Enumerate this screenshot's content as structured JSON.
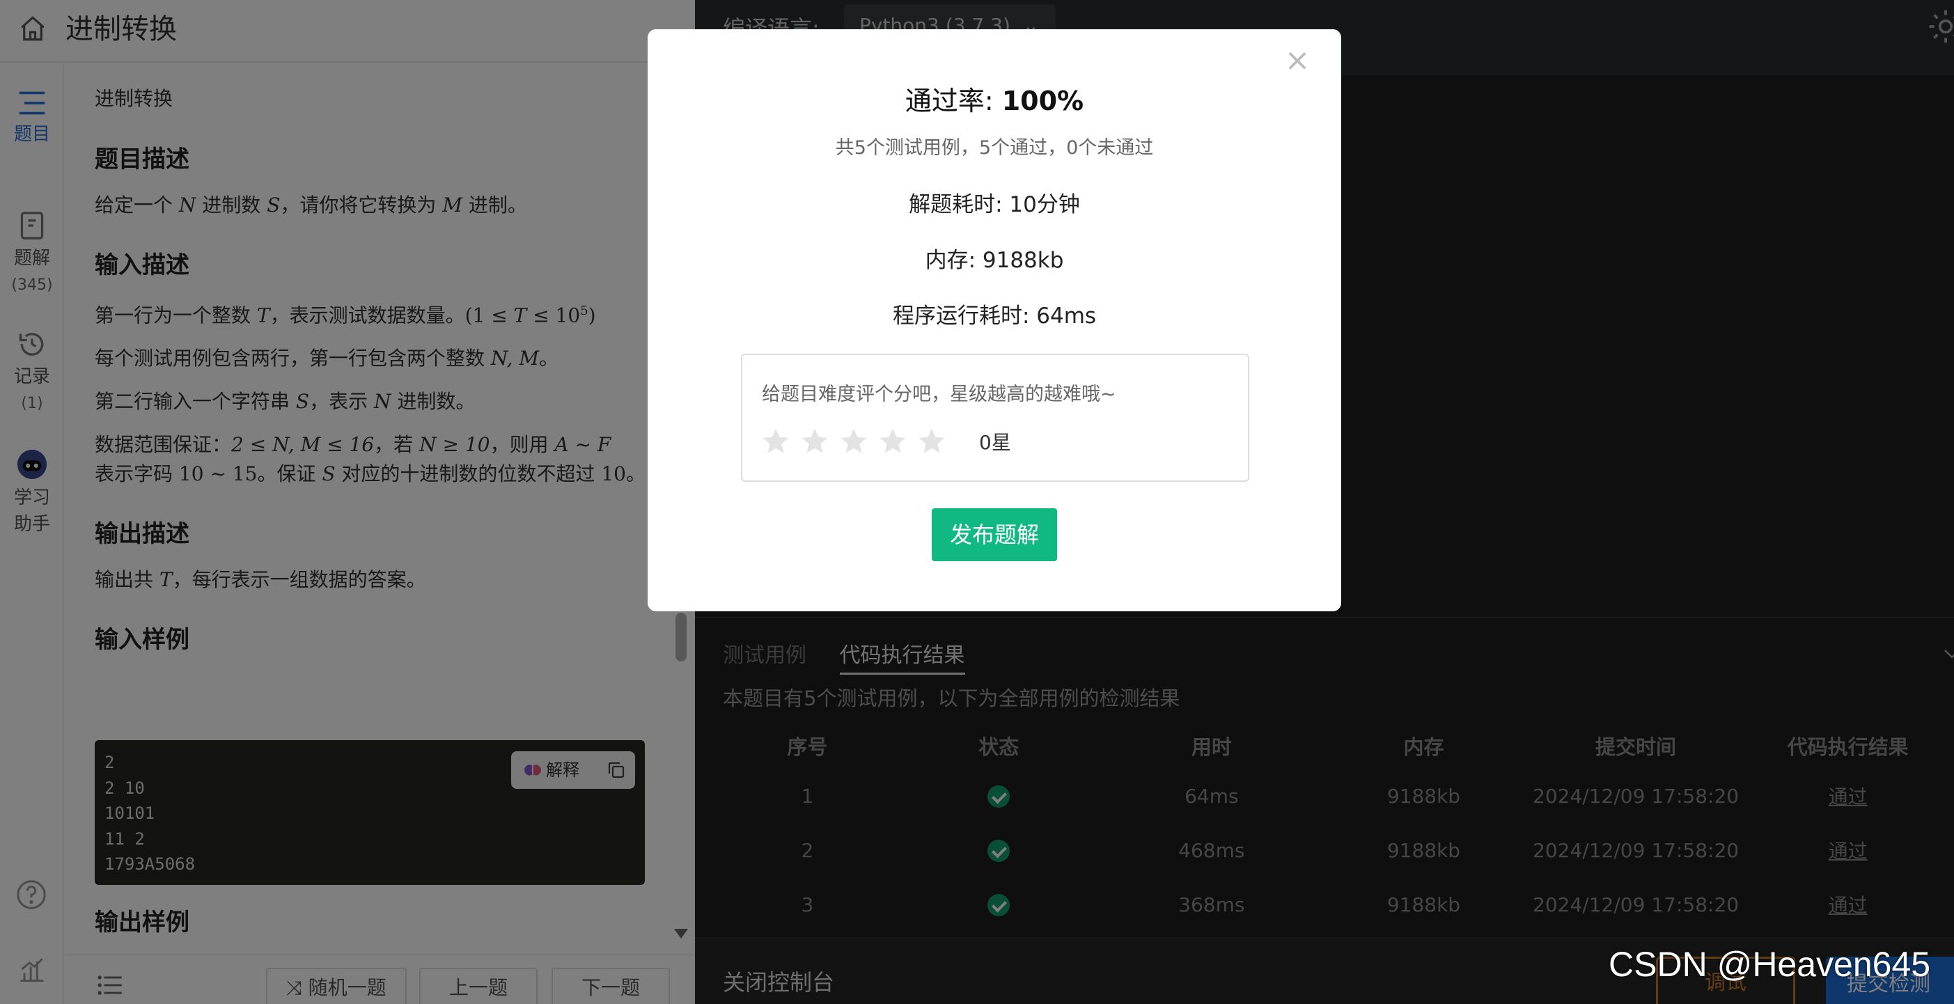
{
  "header": {
    "title": "进制转换"
  },
  "sidenav": {
    "items": [
      {
        "label": "题目"
      },
      {
        "label": "题解",
        "count": "(345)"
      },
      {
        "label": "记录",
        "count": "(1)"
      },
      {
        "label": "学习",
        "label2": "助手"
      }
    ]
  },
  "problem": {
    "breadcrumb": "进制转换",
    "desc_title": "题目描述",
    "desc_pre": "给定一个 ",
    "desc_n": "N",
    "desc_mid": " 进制数 ",
    "desc_s": "S",
    "desc_mid2": "，请你将它转换为 ",
    "desc_m": "M",
    "desc_post": " 进制。",
    "input_title": "输入描述",
    "input_p1_pre": "第一行为一个整数 ",
    "input_p1_t": "T",
    "input_p1_post": "，表示测试数据数量。",
    "input_p1_range_a": "(1 ≤ ",
    "input_p1_range_t": "T",
    "input_p1_range_b": " ≤ 10",
    "input_p1_range_exp": "5",
    "input_p1_range_c": ")",
    "input_p2_pre": "每个测试用例包含两行，第一行包含两个整数 ",
    "input_p2_nm": "N, M",
    "input_p2_post": "。",
    "input_p3_pre": "第二行输入一个字符串 ",
    "input_p3_s": "S",
    "input_p3_mid": "，表示 ",
    "input_p3_n": "N",
    "input_p3_post": " 进制数。",
    "input_p4_l1_pre": "数据范围保证：",
    "input_p4_l1_m1": "2 ≤ N, M ≤ 16",
    "input_p4_l1_mid": "，若 ",
    "input_p4_l1_m2": "N ≥ 10",
    "input_p4_l1_mid2": "，则用 ",
    "input_p4_l1_m3": "A ~ F",
    "input_p4_l2_pre": "表示字码 ",
    "input_p4_l2_m1": "10 ~ 15",
    "input_p4_l2_mid": "。保证 ",
    "input_p4_l2_s": "S",
    "input_p4_l2_post": " 对应的十进制数的位数不超过 ",
    "input_p4_l2_num": "10",
    "input_p4_l2_end": "。",
    "output_title": "输出描述",
    "output_pre": "输出共 ",
    "output_t": "T",
    "output_post": "，每行表示一组数据的答案。",
    "sample_in_title": "输入样例",
    "sample_in_lines": "2\n2 10\n10101\n11 2\n1793A5068",
    "explain_label": "解释",
    "sample_out_title": "输出样例"
  },
  "bottom_bar": {
    "random_label": "随机一题",
    "prev_label": "上一题",
    "next_label": "下一题"
  },
  "editor": {
    "lang_label": "编译语言:",
    "lang_value": "Python3 (3.7.3)"
  },
  "console": {
    "tabs": [
      "测试用例",
      "代码执行结果"
    ],
    "note": "本题目有5个测试用例，以下为全部用例的检测结果",
    "columns": [
      "序号",
      "状态",
      "用时",
      "内存",
      "提交时间",
      "代码执行结果"
    ],
    "rows": [
      {
        "idx": "1",
        "time": "64ms",
        "mem": "9188kb",
        "submitted": "2024/12/09 17:58:20",
        "result": "通过"
      },
      {
        "idx": "2",
        "time": "468ms",
        "mem": "9188kb",
        "submitted": "2024/12/09 17:58:20",
        "result": "通过"
      },
      {
        "idx": "3",
        "time": "368ms",
        "mem": "9188kb",
        "submitted": "2024/12/09 17:58:20",
        "result": "通过"
      }
    ],
    "close_label": "关闭控制台",
    "debug_label": "调试",
    "submit_label": "提交检测"
  },
  "modal": {
    "close_glyph": "×",
    "rate_label": "通过率: ",
    "rate_value": "100%",
    "summary": "共5个测试用例，5个通过，0个未通过",
    "time_spent": "解题耗时: 10分钟",
    "memory": "内存: 9188kb",
    "runtime": "程序运行耗时: 64ms",
    "rating_prompt": "给题目难度评个分吧，星级越高的越难哦~",
    "rating_value": "0星",
    "rating_stars": 0,
    "publish_label": "发布题解"
  },
  "watermark": "CSDN @Heaven645",
  "colors": {
    "accent": "#10b981",
    "nav_active": "#2b6fd6",
    "pass": "#129e6e",
    "submit": "#1d6fd8",
    "debug": "#c8782a"
  }
}
